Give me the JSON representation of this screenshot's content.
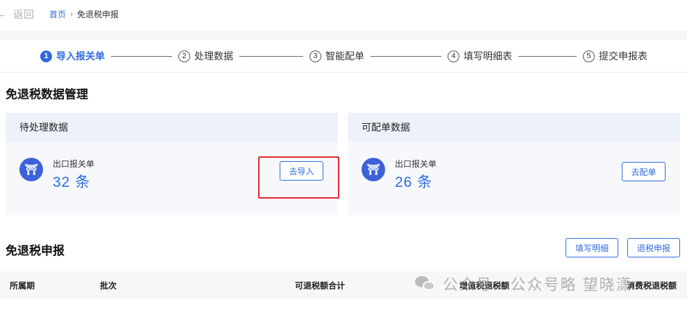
{
  "nav": {
    "back_arrow": "←",
    "back_label": "返回",
    "breadcrumb": {
      "home": "首页",
      "separator": "›",
      "current": "免退税申报"
    }
  },
  "stepper": {
    "steps": [
      {
        "number": "1",
        "label": "导入报关单",
        "active": true
      },
      {
        "number": "2",
        "label": "处理数据",
        "active": false
      },
      {
        "number": "3",
        "label": "智能配单",
        "active": false
      },
      {
        "number": "4",
        "label": "填写明细表",
        "active": false
      },
      {
        "number": "5",
        "label": "提交申报表",
        "active": false
      }
    ]
  },
  "data_section": {
    "title": "免退税数据管理",
    "pending": {
      "header": "待处理数据",
      "item_label": "出口报关单",
      "count": "32 条",
      "button": "去导入"
    },
    "matchable": {
      "header": "可配单数据",
      "item_label": "出口报关单",
      "count": "26 条",
      "button": "去配单"
    }
  },
  "declare_section": {
    "title": "免退税申报",
    "fill_button": "填写明细",
    "refund_button": "退税申报",
    "columns": [
      "所属期",
      "批次",
      "可退税额合计",
      "增值税退税额",
      "消费税退税额"
    ]
  },
  "watermark": {
    "text": "公众号 · 公众号略 望晓潇"
  },
  "colors": {
    "accent": "#2f6be0",
    "highlight": "#e0282e",
    "icon_bg": "#3d62d8"
  },
  "icons": {
    "doc": "customs-doc-icon",
    "watermark": "wechat-icon"
  }
}
